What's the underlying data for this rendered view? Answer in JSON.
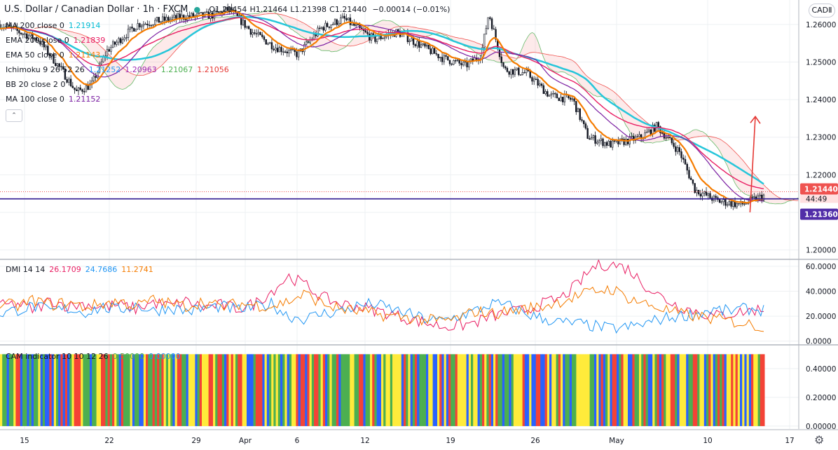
{
  "header": {
    "symbol": "U.S. Dollar / Canadian Dollar · 1h · FXCM",
    "open": "O1.21454",
    "high": "H1.21464",
    "low": "L1.21398",
    "close": "C1.21440",
    "change": "−0.00014 (−0.01%)"
  },
  "currency_button": "CADⅡ",
  "legends": {
    "main": [
      {
        "label": "MA 200 close 0",
        "values": [
          "1.21914"
        ],
        "colors": [
          "#00bcd4"
        ]
      },
      {
        "label": "EMA 200 close 0",
        "values": [
          "1.21839"
        ],
        "colors": [
          "#e91e63"
        ]
      },
      {
        "label": "EMA 50 close 0",
        "values": [
          "1.21143"
        ],
        "colors": [
          "#f57c00"
        ]
      },
      {
        "label": "Ichimoku 9 26 52 26",
        "values": [
          "1.21252",
          "1.20963",
          "1.21067",
          "1.21056"
        ],
        "colors": [
          "#2196f3",
          "#9c27b0",
          "#4caf50",
          "#e53935"
        ]
      },
      {
        "label": "BB 20 close 2 0",
        "values": [],
        "colors": []
      },
      {
        "label": "MA 100 close 0",
        "values": [
          "1.21152"
        ],
        "colors": [
          "#7b1fa2"
        ]
      }
    ],
    "dmi": {
      "label": "DMI 14 14",
      "values": [
        "26.1709",
        "24.7686",
        "11.2741"
      ],
      "colors": [
        "#e91e63",
        "#2196f3",
        "#f57c00"
      ]
    },
    "cam": {
      "label": "CAM indicator 10 10 12 26",
      "values": [
        "0.50000",
        "0.00000"
      ],
      "colors": [
        "#4caf50",
        "#2196f3"
      ]
    }
  },
  "price_badges": {
    "last": "1.21440",
    "countdown": "44:49",
    "line": "1.21360"
  },
  "colors": {
    "up": "#131722",
    "ma200": "#26c6da",
    "ema200": "#e91e63",
    "ema50": "#f57c00",
    "ma100": "#7b1fa2",
    "hline": "#311b92",
    "badge_last": "#ef5350",
    "badge_line": "#512da8",
    "arrow": "#e53935",
    "cam": [
      "#4caf50",
      "#2962ff",
      "#ffeb3b",
      "#f44336"
    ]
  },
  "chart_data": [
    {
      "type": "candlestick",
      "x_tick_labels": [
        "15",
        "22",
        "29",
        "Apr",
        "6",
        "12",
        "19",
        "26",
        "May",
        "10",
        "17"
      ],
      "y_tick_labels": [
        "1.20000",
        "1.21000",
        "1.22000",
        "1.23000",
        "1.24000",
        "1.25000",
        "1.26000"
      ],
      "ylim": [
        1.1975,
        1.2665
      ],
      "price_path": [
        {
          "x": 0,
          "y": 1.26
        },
        {
          "x": 5,
          "y": 1.256
        },
        {
          "x": 8,
          "y": 1.248
        },
        {
          "x": 10,
          "y": 1.242
        },
        {
          "x": 12,
          "y": 1.244
        },
        {
          "x": 14,
          "y": 1.253
        },
        {
          "x": 18,
          "y": 1.26
        },
        {
          "x": 24,
          "y": 1.262
        },
        {
          "x": 28,
          "y": 1.2625
        },
        {
          "x": 30,
          "y": 1.264
        },
        {
          "x": 33,
          "y": 1.258
        },
        {
          "x": 36,
          "y": 1.254
        },
        {
          "x": 39,
          "y": 1.252
        },
        {
          "x": 42,
          "y": 1.259
        },
        {
          "x": 45,
          "y": 1.2615
        },
        {
          "x": 49,
          "y": 1.256
        },
        {
          "x": 52,
          "y": 1.258
        },
        {
          "x": 55,
          "y": 1.2545
        },
        {
          "x": 58,
          "y": 1.251
        },
        {
          "x": 61,
          "y": 1.249
        },
        {
          "x": 63,
          "y": 1.252
        },
        {
          "x": 64,
          "y": 1.263
        },
        {
          "x": 66,
          "y": 1.248
        },
        {
          "x": 69,
          "y": 1.247
        },
        {
          "x": 72,
          "y": 1.241
        },
        {
          "x": 75,
          "y": 1.24
        },
        {
          "x": 77,
          "y": 1.23
        },
        {
          "x": 80,
          "y": 1.228
        },
        {
          "x": 84,
          "y": 1.23
        },
        {
          "x": 86,
          "y": 1.233
        },
        {
          "x": 89,
          "y": 1.226
        },
        {
          "x": 91,
          "y": 1.216
        },
        {
          "x": 94,
          "y": 1.213
        },
        {
          "x": 97,
          "y": 1.212
        },
        {
          "x": 100,
          "y": 1.2144
        }
      ],
      "hline": 1.2136,
      "arrow_from": 1.21,
      "arrow_to": 1.2355
    },
    {
      "type": "line",
      "name": "DMI",
      "y_tick_labels": [
        "0.0000",
        "20.0000",
        "40.0000",
        "60.0000"
      ],
      "ylim": [
        -3,
        65
      ],
      "series": [
        {
          "values": [
            28,
            30,
            25,
            33,
            28,
            30,
            27,
            29,
            26,
            31,
            28,
            32,
            27,
            29,
            26,
            30,
            40,
            52,
            45,
            35,
            30,
            28,
            25,
            22,
            18,
            15,
            12,
            12,
            15,
            20,
            23,
            25,
            30,
            34,
            45,
            60,
            62,
            58,
            45,
            35,
            28,
            24,
            20,
            22,
            24,
            26
          ]
        },
        {
          "values": [
            22,
            25,
            28,
            24,
            26,
            23,
            27,
            25,
            29,
            24,
            27,
            24,
            26,
            28,
            25,
            27,
            30,
            20,
            18,
            22,
            24,
            28,
            30,
            26,
            22,
            18,
            16,
            20,
            24,
            30,
            28,
            22,
            18,
            15,
            14,
            12,
            10,
            11,
            14,
            18,
            20,
            22,
            25,
            24,
            26,
            25
          ]
        },
        {
          "values": [
            30,
            28,
            33,
            29,
            31,
            27,
            30,
            32,
            28,
            33,
            30,
            28,
            32,
            27,
            30,
            29,
            28,
            32,
            38,
            30,
            26,
            24,
            22,
            20,
            19,
            17,
            16,
            18,
            24,
            22,
            24,
            26,
            28,
            32,
            36,
            40,
            42,
            35,
            30,
            26,
            22,
            20,
            18,
            16,
            14,
            11
          ]
        }
      ]
    },
    {
      "type": "bar",
      "name": "CAM",
      "y_tick_labels": [
        "0.00000",
        "0.20000",
        "0.40000"
      ],
      "ylim": [
        -0.02,
        0.56
      ],
      "values": [
        0.5
      ]
    }
  ]
}
